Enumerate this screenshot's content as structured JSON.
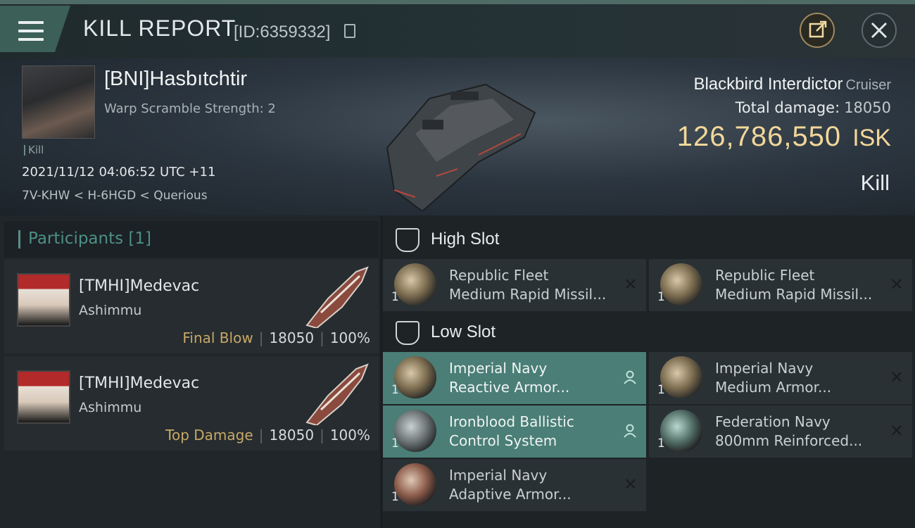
{
  "header": {
    "title": "KILL REPORT",
    "report_id": "[ID:6359332]"
  },
  "victim": {
    "name": "[BNI]Hasbıtchtir",
    "subtitle": "Warp Scramble Strength: 2",
    "tag": "Kill",
    "datetime": "2021/11/12 04:06:52 UTC +11",
    "location": "7V-KHW < H-6HGD < Querious"
  },
  "ship": {
    "name": "Blackbird Interdictor",
    "class": "Cruiser",
    "total_damage_label": "Total damage:",
    "total_damage": "18050",
    "isk_value": "126,786,550",
    "isk_unit": "ISK",
    "result": "Kill"
  },
  "participants": {
    "title": "Participants [1]",
    "rows": [
      {
        "name": "[TMHI]Medevac",
        "ship": "Ashimmu",
        "role": "Final Blow",
        "damage": "18050",
        "percent": "100%"
      },
      {
        "name": "[TMHI]Medevac",
        "ship": "Ashimmu",
        "role": "Top Damage",
        "damage": "18050",
        "percent": "100%"
      }
    ]
  },
  "slots": {
    "high": {
      "title": "High Slot",
      "items": [
        {
          "line1": "Republic Fleet",
          "line2": "Medium Rapid Missil...",
          "qty": "1"
        },
        {
          "line1": "Republic Fleet",
          "line2": "Medium Rapid Missil...",
          "qty": "1"
        }
      ]
    },
    "low": {
      "title": "Low Slot",
      "items": [
        {
          "line1": "Imperial Navy",
          "line2": "Reactive Armor...",
          "qty": "1",
          "state": "dropped"
        },
        {
          "line1": "Imperial Navy",
          "line2": "Medium Armor...",
          "qty": "1",
          "state": "destroyed"
        },
        {
          "line1": "Ironblood Ballistic",
          "line2": "Control System",
          "qty": "1",
          "state": "dropped"
        },
        {
          "line1": "Federation Navy",
          "line2": "800mm Reinforced...",
          "qty": "1",
          "state": "destroyed"
        },
        {
          "line1": "Imperial Navy",
          "line2": "Adaptive Armor...",
          "qty": "1",
          "state": "destroyed"
        }
      ]
    }
  },
  "icons": {
    "destroyed": "✕",
    "colors": {
      "accent": "#4a7e76",
      "isk": "#f2d79a",
      "role": "#c7a867"
    }
  }
}
